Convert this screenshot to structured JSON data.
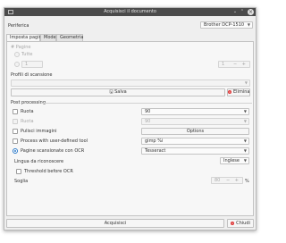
{
  "window": {
    "title": "Acquisisci il documento"
  },
  "device": {
    "label": "Periferica",
    "value": "Brother DCP-1510"
  },
  "tabs": [
    {
      "label": "Imposta pagina"
    },
    {
      "label": "Mode"
    },
    {
      "label": "Geometria"
    }
  ],
  "pages": {
    "label": "# Pagine",
    "all_label": "Tutte",
    "count_value": "1",
    "page_value": "1"
  },
  "scan_profile": {
    "label": "Profili di scansione",
    "save_label": "Salva",
    "delete_label": "Elimina"
  },
  "post_processing": {
    "label": "Post processing",
    "rotate_label": "Ruota",
    "rotate_value": "90",
    "rotate_both_label": "Ruota",
    "rotate_both_value": "90",
    "clean_label": "Pulisci immagini",
    "options_label": "Options",
    "udt_label": "Process with user-defined tool",
    "udt_value": "gimp %i",
    "ocr_label": "Pagine scansionate con OCR",
    "ocr_value": "Tesseract",
    "language_label": "Lingua da riconoscere",
    "language_value": "Inglese",
    "threshold_label": "Threshold before OCR",
    "soglia_label": "Soglia",
    "soglia_value": "80",
    "soglia_unit": "%"
  },
  "footer": {
    "acquire_label": "Acquisisci",
    "close_label": "Chiudi"
  }
}
